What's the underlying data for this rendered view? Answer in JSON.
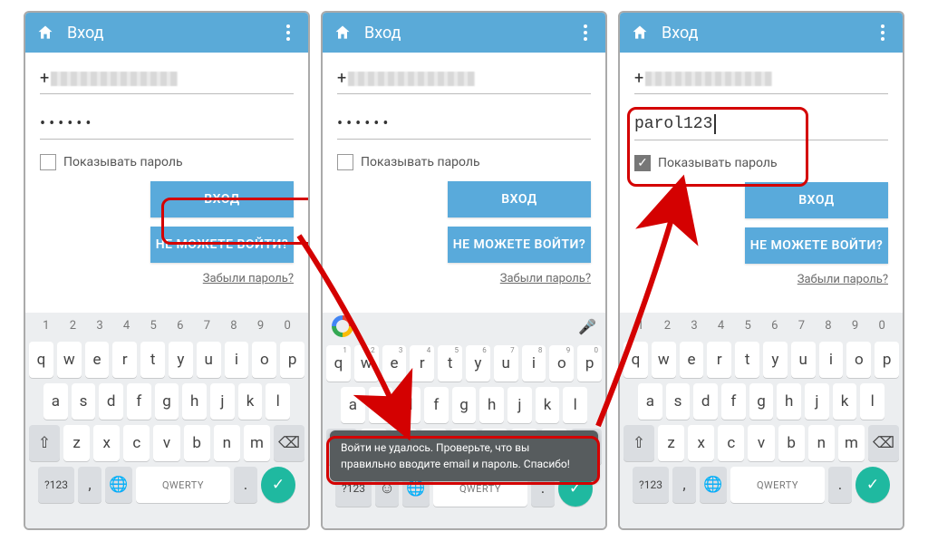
{
  "appbar": {
    "title": "Вход"
  },
  "form": {
    "phone_prefix": "+",
    "password_dots": "••••••",
    "password_visible": "parol123",
    "show_password_label": "Показывать пароль",
    "login_btn": "ВХОД",
    "cant_login_btn": "НЕ МОЖЕТЕ ВОЙТИ?",
    "forgot_link": "Забыли пароль?"
  },
  "toast": {
    "message": "Войти не удалось. Проверьте, что вы правильно вводите email и пароль. Спасибо!"
  },
  "keyboard": {
    "numbers": [
      "1",
      "2",
      "3",
      "4",
      "5",
      "6",
      "7",
      "8",
      "9",
      "0"
    ],
    "row1": [
      "q",
      "w",
      "e",
      "r",
      "t",
      "y",
      "u",
      "i",
      "o",
      "p"
    ],
    "row1_exp": [
      "",
      "",
      "",
      "",
      "",
      "",
      "",
      "",
      "",
      ""
    ],
    "row2": [
      "a",
      "s",
      "d",
      "f",
      "g",
      "h",
      "j",
      "k",
      "l"
    ],
    "row3": [
      "z",
      "x",
      "c",
      "v",
      "b",
      "n",
      "m"
    ],
    "sym_key": "?123",
    "space_label": "QWERTY",
    "comma": ",",
    "period": ".",
    "shift_glyph": "⇧",
    "backspace_glyph": "⌫",
    "globe_glyph": "🌐",
    "mic_glyph": "🎤",
    "smile_glyph": "☺",
    "check_glyph": "✓"
  }
}
